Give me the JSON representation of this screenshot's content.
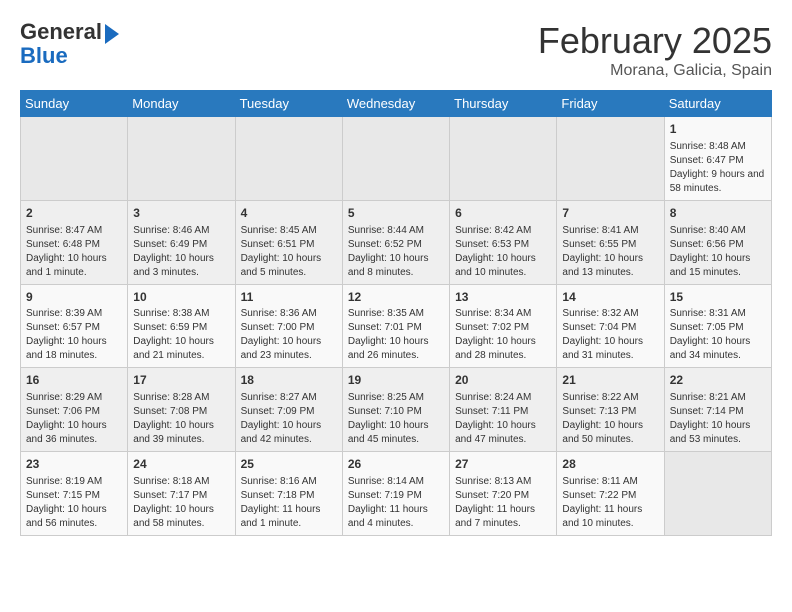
{
  "header": {
    "logo_line1": "General",
    "logo_line2": "Blue",
    "month": "February 2025",
    "location": "Morana, Galicia, Spain"
  },
  "weekdays": [
    "Sunday",
    "Monday",
    "Tuesday",
    "Wednesday",
    "Thursday",
    "Friday",
    "Saturday"
  ],
  "weeks": [
    [
      {
        "day": "",
        "info": ""
      },
      {
        "day": "",
        "info": ""
      },
      {
        "day": "",
        "info": ""
      },
      {
        "day": "",
        "info": ""
      },
      {
        "day": "",
        "info": ""
      },
      {
        "day": "",
        "info": ""
      },
      {
        "day": "1",
        "info": "Sunrise: 8:48 AM\nSunset: 6:47 PM\nDaylight: 9 hours and 58 minutes."
      }
    ],
    [
      {
        "day": "2",
        "info": "Sunrise: 8:47 AM\nSunset: 6:48 PM\nDaylight: 10 hours and 1 minute."
      },
      {
        "day": "3",
        "info": "Sunrise: 8:46 AM\nSunset: 6:49 PM\nDaylight: 10 hours and 3 minutes."
      },
      {
        "day": "4",
        "info": "Sunrise: 8:45 AM\nSunset: 6:51 PM\nDaylight: 10 hours and 5 minutes."
      },
      {
        "day": "5",
        "info": "Sunrise: 8:44 AM\nSunset: 6:52 PM\nDaylight: 10 hours and 8 minutes."
      },
      {
        "day": "6",
        "info": "Sunrise: 8:42 AM\nSunset: 6:53 PM\nDaylight: 10 hours and 10 minutes."
      },
      {
        "day": "7",
        "info": "Sunrise: 8:41 AM\nSunset: 6:55 PM\nDaylight: 10 hours and 13 minutes."
      },
      {
        "day": "8",
        "info": "Sunrise: 8:40 AM\nSunset: 6:56 PM\nDaylight: 10 hours and 15 minutes."
      }
    ],
    [
      {
        "day": "9",
        "info": "Sunrise: 8:39 AM\nSunset: 6:57 PM\nDaylight: 10 hours and 18 minutes."
      },
      {
        "day": "10",
        "info": "Sunrise: 8:38 AM\nSunset: 6:59 PM\nDaylight: 10 hours and 21 minutes."
      },
      {
        "day": "11",
        "info": "Sunrise: 8:36 AM\nSunset: 7:00 PM\nDaylight: 10 hours and 23 minutes."
      },
      {
        "day": "12",
        "info": "Sunrise: 8:35 AM\nSunset: 7:01 PM\nDaylight: 10 hours and 26 minutes."
      },
      {
        "day": "13",
        "info": "Sunrise: 8:34 AM\nSunset: 7:02 PM\nDaylight: 10 hours and 28 minutes."
      },
      {
        "day": "14",
        "info": "Sunrise: 8:32 AM\nSunset: 7:04 PM\nDaylight: 10 hours and 31 minutes."
      },
      {
        "day": "15",
        "info": "Sunrise: 8:31 AM\nSunset: 7:05 PM\nDaylight: 10 hours and 34 minutes."
      }
    ],
    [
      {
        "day": "16",
        "info": "Sunrise: 8:29 AM\nSunset: 7:06 PM\nDaylight: 10 hours and 36 minutes."
      },
      {
        "day": "17",
        "info": "Sunrise: 8:28 AM\nSunset: 7:08 PM\nDaylight: 10 hours and 39 minutes."
      },
      {
        "day": "18",
        "info": "Sunrise: 8:27 AM\nSunset: 7:09 PM\nDaylight: 10 hours and 42 minutes."
      },
      {
        "day": "19",
        "info": "Sunrise: 8:25 AM\nSunset: 7:10 PM\nDaylight: 10 hours and 45 minutes."
      },
      {
        "day": "20",
        "info": "Sunrise: 8:24 AM\nSunset: 7:11 PM\nDaylight: 10 hours and 47 minutes."
      },
      {
        "day": "21",
        "info": "Sunrise: 8:22 AM\nSunset: 7:13 PM\nDaylight: 10 hours and 50 minutes."
      },
      {
        "day": "22",
        "info": "Sunrise: 8:21 AM\nSunset: 7:14 PM\nDaylight: 10 hours and 53 minutes."
      }
    ],
    [
      {
        "day": "23",
        "info": "Sunrise: 8:19 AM\nSunset: 7:15 PM\nDaylight: 10 hours and 56 minutes."
      },
      {
        "day": "24",
        "info": "Sunrise: 8:18 AM\nSunset: 7:17 PM\nDaylight: 10 hours and 58 minutes."
      },
      {
        "day": "25",
        "info": "Sunrise: 8:16 AM\nSunset: 7:18 PM\nDaylight: 11 hours and 1 minute."
      },
      {
        "day": "26",
        "info": "Sunrise: 8:14 AM\nSunset: 7:19 PM\nDaylight: 11 hours and 4 minutes."
      },
      {
        "day": "27",
        "info": "Sunrise: 8:13 AM\nSunset: 7:20 PM\nDaylight: 11 hours and 7 minutes."
      },
      {
        "day": "28",
        "info": "Sunrise: 8:11 AM\nSunset: 7:22 PM\nDaylight: 11 hours and 10 minutes."
      },
      {
        "day": "",
        "info": ""
      }
    ]
  ]
}
